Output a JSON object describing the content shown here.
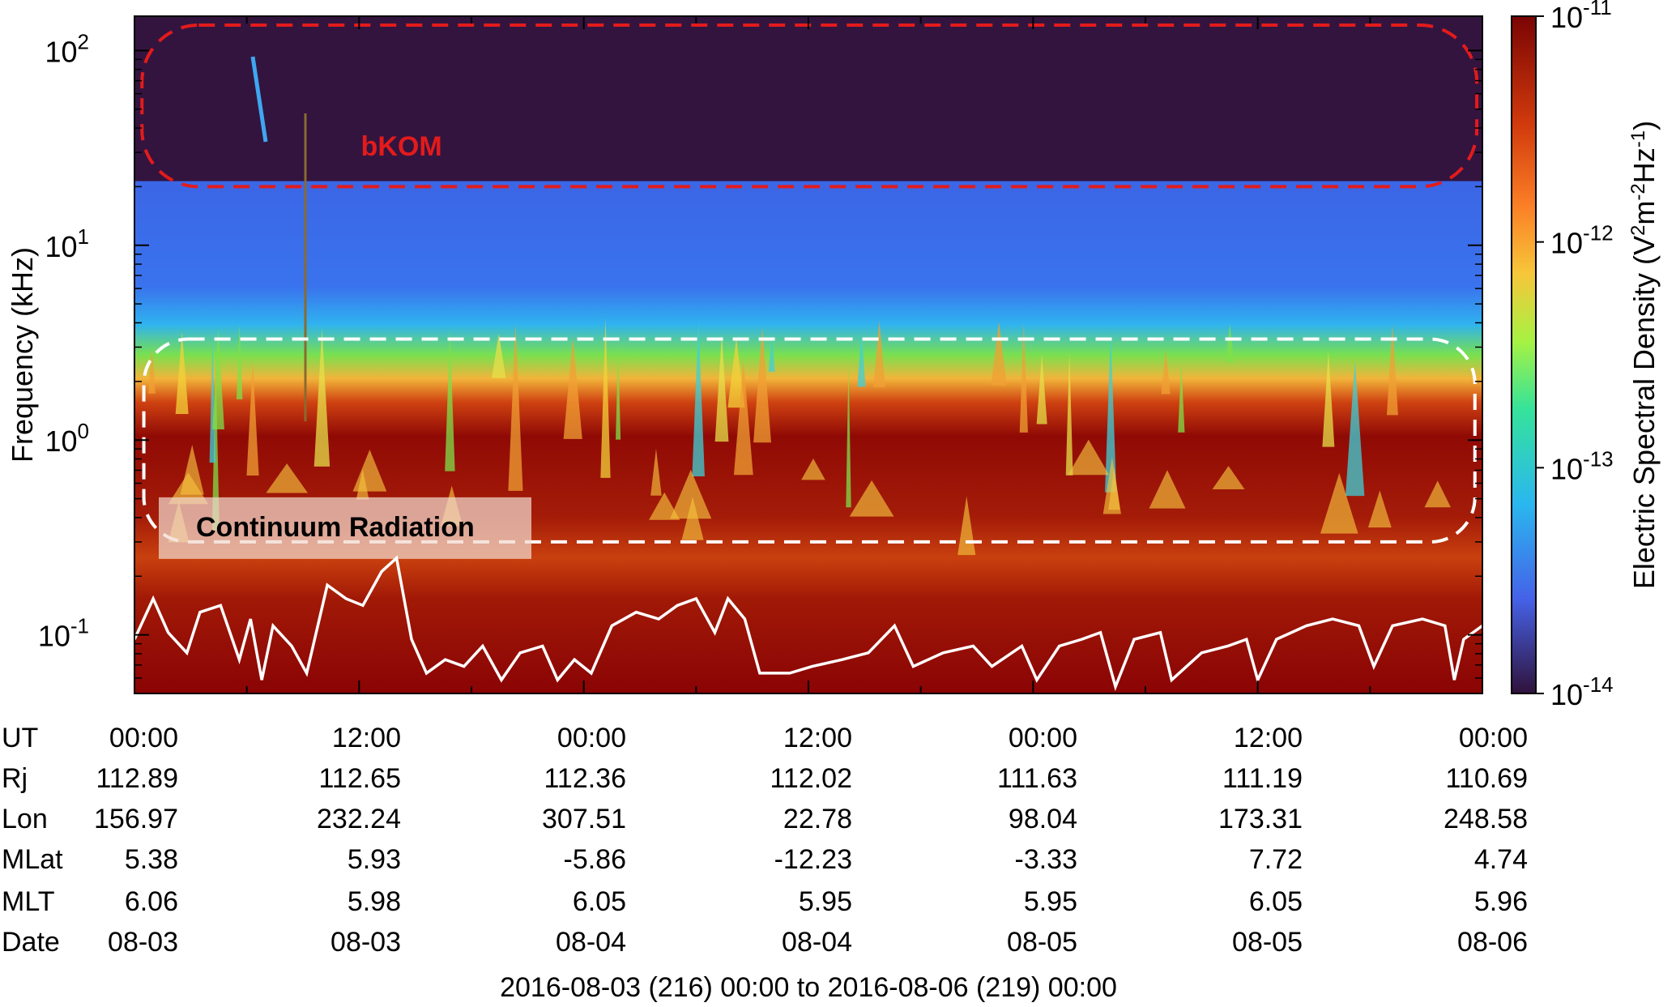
{
  "chart_data": {
    "type": "heatmap",
    "title": "",
    "xlabel": "",
    "ylabel": "Frequency (kHz)",
    "colorbar_label": "Electric Spectral Density (V²m⁻²Hz⁻¹)",
    "colorbar_label_parts": {
      "main": "Electric Spectral Density (V",
      "e1": "2",
      "m": "m",
      "e2": "-2",
      "hz": "Hz",
      "e3": "-1",
      "close": ")"
    },
    "y_scale": "log",
    "ylim": [
      0.05,
      150
    ],
    "y_ticks": [
      {
        "value": 0.1,
        "base": "10",
        "exp": "-1"
      },
      {
        "value": 1,
        "base": "10",
        "exp": "0"
      },
      {
        "value": 10,
        "base": "10",
        "exp": "1"
      },
      {
        "value": 100,
        "base": "10",
        "exp": "2"
      }
    ],
    "color_scale": "log",
    "clim": [
      1e-14,
      1e-11
    ],
    "colorbar_ticks": [
      {
        "value": 1e-11,
        "base": "10",
        "exp": "-11"
      },
      {
        "value": 1e-12,
        "base": "10",
        "exp": "-12"
      },
      {
        "value": 1e-13,
        "base": "10",
        "exp": "-13"
      },
      {
        "value": 1e-14,
        "base": "10",
        "exp": "-14"
      }
    ],
    "x_range_hours": [
      0,
      72
    ],
    "x_major_hours": [
      0,
      12,
      24,
      36,
      48,
      60,
      72
    ],
    "x_minor_hours": [
      6,
      18,
      30,
      42,
      54,
      66
    ],
    "time_range_label": "2016-08-03 (216) 00:00  to  2016-08-06 (219) 00:00",
    "ephemeris": {
      "labels": [
        "UT",
        "Rj",
        "Lon",
        "MLat",
        "MLT",
        "Date"
      ],
      "rows": [
        [
          "00:00",
          "12:00",
          "00:00",
          "12:00",
          "00:00",
          "12:00",
          "00:00"
        ],
        [
          "112.89",
          "112.65",
          "112.36",
          "112.02",
          "111.63",
          "111.19",
          "110.69"
        ],
        [
          "156.97",
          "232.24",
          "307.51",
          "22.78",
          "98.04",
          "173.31",
          "248.58"
        ],
        [
          "5.38",
          "5.93",
          "-5.86",
          "-12.23",
          "-3.33",
          "7.72",
          "4.74"
        ],
        [
          "6.06",
          "5.98",
          "6.05",
          "5.95",
          "5.95",
          "6.05",
          "5.96"
        ],
        [
          "08-03",
          "08-03",
          "08-04",
          "08-04",
          "08-05",
          "08-05",
          "08-06"
        ]
      ]
    },
    "annotations": [
      {
        "text": "bKOM",
        "color": "#e31b1b",
        "x_hours": 9.5,
        "freq_khz": 35
      },
      {
        "text": "Continuum Radiation",
        "color": "#000000",
        "x_hours": 12,
        "freq_khz": 0.36
      }
    ],
    "regions": [
      {
        "name": "bKOM",
        "style": "red-dashed",
        "x_hours": [
          0.4,
          71.7
        ],
        "freq_khz": [
          20,
          135
        ]
      },
      {
        "name": "Continuum Radiation",
        "style": "white-dashed",
        "x_hours": [
          0.5,
          71.6
        ],
        "freq_khz": [
          0.3,
          3.3
        ]
      }
    ],
    "overlay_line": {
      "color": "#ffffff",
      "units": "relative plot height",
      "points": [
        [
          0,
          0.08
        ],
        [
          1.0,
          0.14
        ],
        [
          1.8,
          0.09
        ],
        [
          2.8,
          0.06
        ],
        [
          3.5,
          0.12
        ],
        [
          4.6,
          0.13
        ],
        [
          5.6,
          0.05
        ],
        [
          6.2,
          0.11
        ],
        [
          6.8,
          0.02
        ],
        [
          7.4,
          0.1
        ],
        [
          8.4,
          0.07
        ],
        [
          9.2,
          0.03
        ],
        [
          10.3,
          0.16
        ],
        [
          11.3,
          0.14
        ],
        [
          12.2,
          0.13
        ],
        [
          13.2,
          0.18
        ],
        [
          14.0,
          0.2
        ],
        [
          14.8,
          0.08
        ],
        [
          15.6,
          0.03
        ],
        [
          16.6,
          0.05
        ],
        [
          17.6,
          0.04
        ],
        [
          18.6,
          0.07
        ],
        [
          19.6,
          0.02
        ],
        [
          20.6,
          0.06
        ],
        [
          21.8,
          0.07
        ],
        [
          22.6,
          0.02
        ],
        [
          23.5,
          0.05
        ],
        [
          24.4,
          0.03
        ],
        [
          25.5,
          0.1
        ],
        [
          26.8,
          0.12
        ],
        [
          28.0,
          0.11
        ],
        [
          29.0,
          0.13
        ],
        [
          30.0,
          0.14
        ],
        [
          31.0,
          0.09
        ],
        [
          31.7,
          0.14
        ],
        [
          32.6,
          0.11
        ],
        [
          33.4,
          0.03
        ],
        [
          35.0,
          0.03
        ],
        [
          36.2,
          0.04
        ],
        [
          37.8,
          0.05
        ],
        [
          39.2,
          0.06
        ],
        [
          40.6,
          0.1
        ],
        [
          41.6,
          0.04
        ],
        [
          43.2,
          0.06
        ],
        [
          44.8,
          0.07
        ],
        [
          45.8,
          0.04
        ],
        [
          47.4,
          0.07
        ],
        [
          48.2,
          0.02
        ],
        [
          49.4,
          0.07
        ],
        [
          50.6,
          0.08
        ],
        [
          51.6,
          0.09
        ],
        [
          52.4,
          0.01
        ],
        [
          53.4,
          0.08
        ],
        [
          54.8,
          0.09
        ],
        [
          55.4,
          0.02
        ],
        [
          57.0,
          0.06
        ],
        [
          58.4,
          0.07
        ],
        [
          59.4,
          0.08
        ],
        [
          60.0,
          0.02
        ],
        [
          61.0,
          0.08
        ],
        [
          62.6,
          0.1
        ],
        [
          64.0,
          0.11
        ],
        [
          65.4,
          0.1
        ],
        [
          66.2,
          0.04
        ],
        [
          67.2,
          0.1
        ],
        [
          68.8,
          0.11
        ],
        [
          70.0,
          0.1
        ],
        [
          70.5,
          0.02
        ],
        [
          71.0,
          0.08
        ],
        [
          72.0,
          0.1
        ]
      ]
    }
  }
}
